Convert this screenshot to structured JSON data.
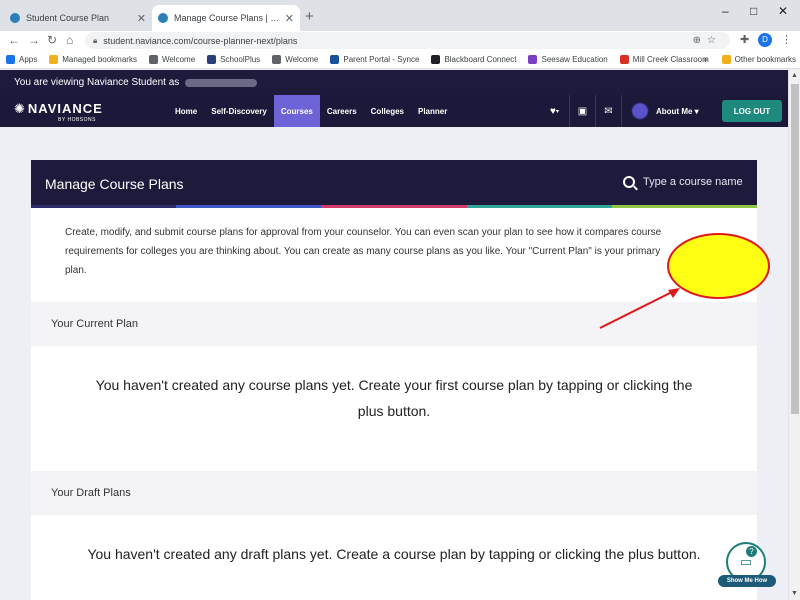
{
  "browser": {
    "tabs": [
      {
        "title": "Student Course Plan",
        "active": false
      },
      {
        "title": "Manage Course Plans | Course Pl",
        "active": true
      }
    ],
    "new_tab": "+",
    "window_controls": {
      "minimize": "–",
      "maximize": "□",
      "close": "✕"
    },
    "url": "student.naviance.com/course-planner-next/plans",
    "profile_initial": "D",
    "bookmarks": [
      {
        "label": "Apps",
        "color": "#1a73e8"
      },
      {
        "label": "Managed bookmarks",
        "color": "#f2b01e"
      },
      {
        "label": "Welcome",
        "color": "#5f6368"
      },
      {
        "label": "SchoolPlus",
        "color": "#2a3f7a"
      },
      {
        "label": "Welcome",
        "color": "#5f6368"
      },
      {
        "label": "Parent Portal - Synce",
        "color": "#1a4f9c"
      },
      {
        "label": "Blackboard Connect",
        "color": "#202124"
      },
      {
        "label": "Seesaw Education",
        "color": "#7b3fc4"
      },
      {
        "label": "Mill Creek Classroom",
        "color": "#d93025"
      }
    ],
    "bookmarks_more": "»",
    "other_bookmarks": "Other bookmarks"
  },
  "naviance": {
    "viewing_text": "You are viewing Naviance Student as",
    "logo_text": "NAVIANCE",
    "logo_sub": "BY HOBSONS",
    "nav": [
      "Home",
      "Self-Discovery",
      "Courses",
      "Careers",
      "Colleges",
      "Planner"
    ],
    "active_nav": "Courses",
    "about_me": "About Me ▾",
    "logout": "LOG OUT"
  },
  "card": {
    "title": "Manage Course Plans",
    "search_placeholder": "Type a course name",
    "strip_colors": [
      "#2e2a6a",
      "#3d57c7",
      "#d13b6b",
      "#2fa79b",
      "#8fc742"
    ],
    "intro": "Create, modify, and submit course plans for approval from your counselor. You can even scan your plan to see how it compares course requirements for colleges you are thinking about. You can create as many course plans as you like. Your \"Current Plan\" is your primary plan.",
    "current_plan": {
      "title": "Your Current Plan",
      "empty": "You haven't created any course plans yet. Create your first course plan by tapping or clicking the plus button."
    },
    "draft_plans": {
      "title": "Your Draft Plans",
      "empty": "You haven't created any draft plans yet. Create a course plan by tapping or clicking the plus button."
    }
  },
  "help": {
    "show_me_how": "Show Me How",
    "badge": "?"
  }
}
